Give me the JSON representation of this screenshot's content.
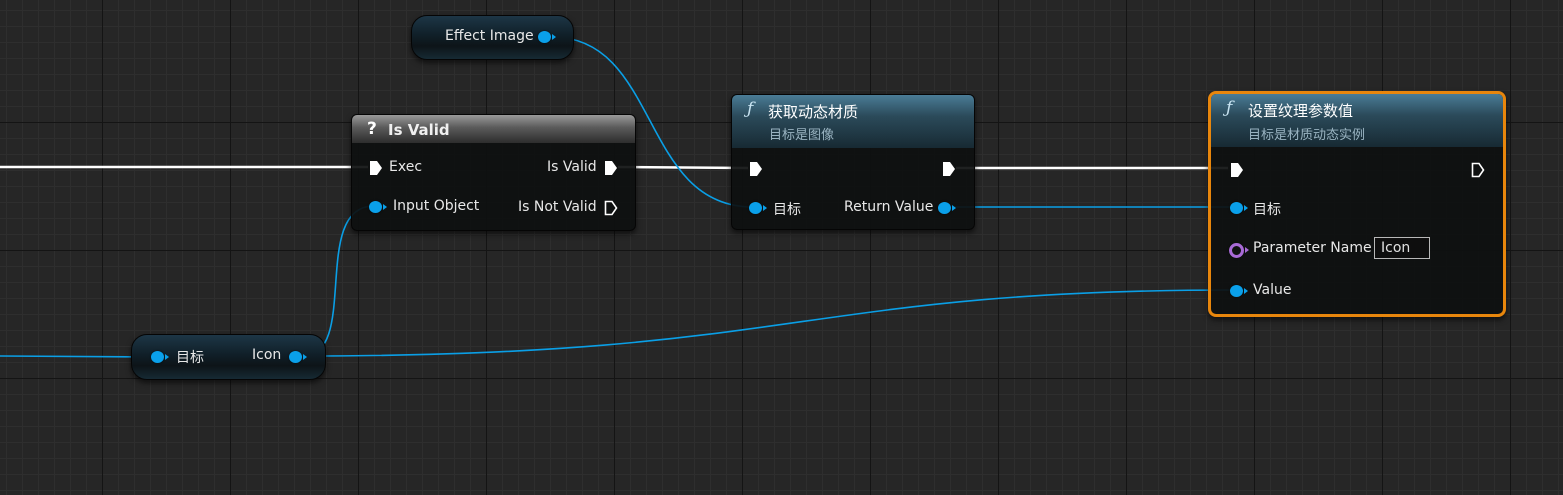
{
  "nodes": {
    "effect_image": {
      "label": "Effect Image"
    },
    "is_valid": {
      "icon": "?",
      "title": "Is Valid",
      "in_exec": "Exec",
      "in_object": "Input Object",
      "out_valid": "Is Valid",
      "out_not_valid": "Is Not Valid"
    },
    "get_dynamic_material": {
      "icon": "ƒ",
      "title": "获取动态材质",
      "subtitle": "目标是图像",
      "in_target": "目标",
      "out_return": "Return Value"
    },
    "set_texture_param": {
      "icon": "ƒ",
      "title": "设置纹理参数值",
      "subtitle": "目标是材质动态实例",
      "in_target": "目标",
      "in_param_name": "Parameter Name",
      "param_name_value": "Icon",
      "in_value": "Value"
    },
    "get_icon": {
      "in_target": "目标",
      "out_icon": "Icon"
    }
  },
  "colors": {
    "object_pin": "#0aa0ea",
    "name_pin": "#a86ad6",
    "selection": "#e8860c",
    "exec_wire": "#ffffff"
  }
}
